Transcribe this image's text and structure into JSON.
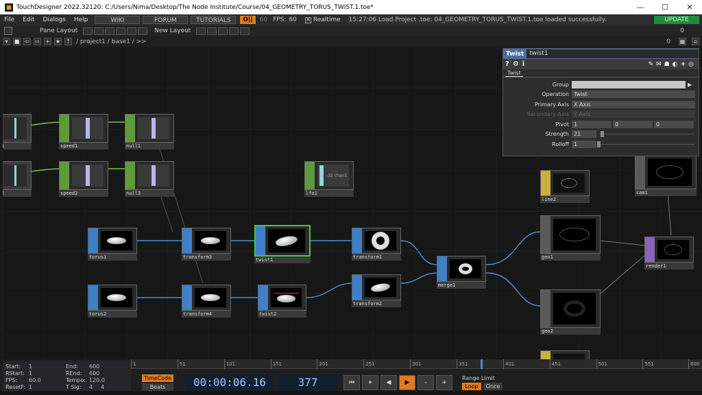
{
  "window": {
    "title": "TouchDesigner 2022.32120: C:/Users/Nima/Desktop/The Node Institute/Course/04_GEOMETRY_TORUS_TWIST.1.toe*",
    "minimize": "—",
    "maximize": "☐",
    "close": "✕"
  },
  "menubar": {
    "items": [
      "File",
      "Edit",
      "Dialogs",
      "Help"
    ],
    "wiki": "WIKI",
    "forum": "FORUM",
    "tutorials": "TUTORIALS",
    "perform": "O||",
    "sixty": "60",
    "fps_label": "FPS:",
    "fps_value": "60",
    "realtime_check": "✕",
    "realtime": "Realtime",
    "status": "15:27:06 Load Project .toe: 04_GEOMETRY_TORUS_TWIST.1.toe loaded successfully.",
    "update": "UPDATE"
  },
  "panebar": {
    "pane_layout": "Pane Layout",
    "new_layout": "New Layout",
    "zero": "0"
  },
  "pathbar": {
    "path": "/ project1 / base1 / >>",
    "zero": "0"
  },
  "nodes": {
    "r1c0": "1",
    "r2c0": "2",
    "speed1": "speed1",
    "null1": "null1",
    "speed2": "speed2",
    "null3": "null3",
    "lfo1": "lfo1",
    "lfo1_thumb": "-32 chan1",
    "torus1": "torus1",
    "transform3": "transform3",
    "twist1": "twist1",
    "transform1": "transform1",
    "torus2": "torus2",
    "transform4": "transform4",
    "twist2": "twist2",
    "transform2": "transform2",
    "merge1": "merge1",
    "line2": "line2",
    "geo1": "geo1",
    "geo2": "geo2",
    "cam1": "cam1",
    "render1": "render1",
    "plus": "+"
  },
  "params": {
    "op_type": "Twist",
    "op_name": "twist1",
    "tab": "Twist",
    "tools_left": [
      "?",
      "⚙",
      "i"
    ],
    "tools_right": [
      "✎",
      "✉",
      "☗",
      "◐",
      "+",
      "◎"
    ],
    "rows": [
      {
        "label": "Group",
        "value": ""
      },
      {
        "label": "Operation",
        "value": "Twist"
      },
      {
        "label": "Primary Axis",
        "value": "X Axis"
      },
      {
        "label": "Secondary Axis",
        "value": "Y Axis"
      },
      {
        "label": "Pivot",
        "values": [
          "1",
          "0",
          "0"
        ]
      },
      {
        "label": "Strength",
        "value": "21"
      },
      {
        "label": "Rolloff",
        "value": "1"
      }
    ]
  },
  "timeinfo": {
    "start_label": "Start:",
    "start": "1",
    "rstart_label": "RStart:",
    "rstart": "1",
    "fps_label": "FPS:",
    "fps": "60.0",
    "resetf_label": "ResetF:",
    "resetf": "1",
    "end_label": "End:",
    "end": "600",
    "rend_label": "REnd:",
    "rend": "600",
    "tempo_label": "Tempo:",
    "tempo": "120.0",
    "tsig_label": "T Sig:",
    "tsig1": "4",
    "tsig2": "4"
  },
  "timeline": {
    "ticks": [
      "1",
      "51",
      "101",
      "151",
      "201",
      "251",
      "301",
      "351",
      "401",
      "451",
      "501",
      "551",
      "600"
    ],
    "current_frame": 377
  },
  "transport": {
    "timecode_btn": "TimeCode",
    "beats_btn": "Beats",
    "timecode": "00:00:06.16",
    "frame": "377",
    "range_limit": "Range Limit",
    "loop": "Loop",
    "once": "Once",
    "btn_start": "⏮",
    "btn_pause": "⏸",
    "btn_back": "◀",
    "btn_play": "▶",
    "btn_minus": "-",
    "btn_plus": "+"
  }
}
